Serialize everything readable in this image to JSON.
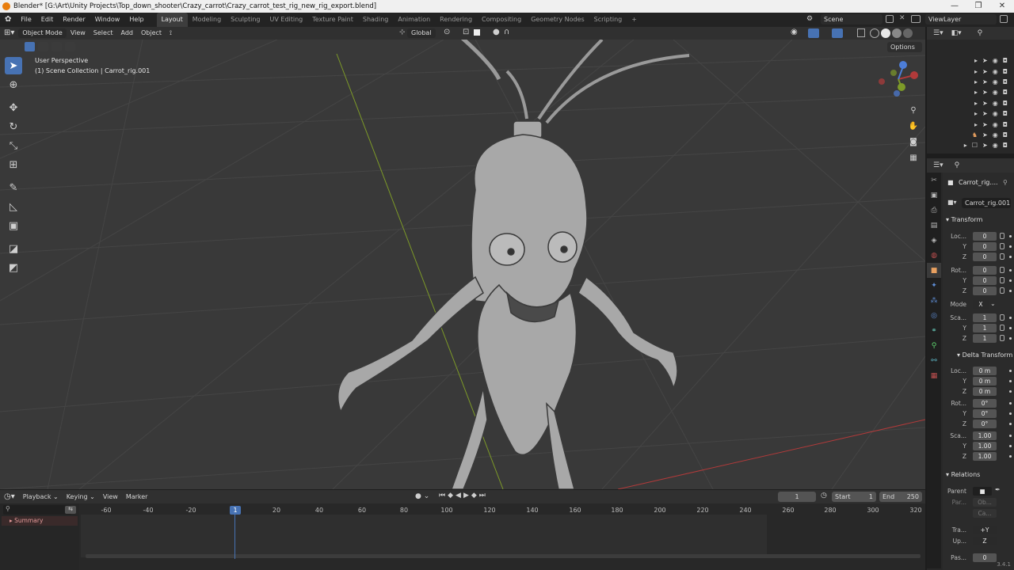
{
  "window": {
    "title": "Blender* [G:\\Art\\Unity Projects\\Top_down_shooter\\Crazy_carrot\\Crazy_carrot_test_rig_new_rig_export.blend]",
    "controls": [
      "—",
      "❐",
      "✕"
    ]
  },
  "menubar": {
    "items": [
      "File",
      "Edit",
      "Render",
      "Window",
      "Help"
    ],
    "workspaces": [
      "Layout",
      "Modeling",
      "Sculpting",
      "UV Editing",
      "Texture Paint",
      "Shading",
      "Animation",
      "Rendering",
      "Compositing",
      "Geometry Nodes",
      "Scripting"
    ],
    "active_workspace": "Layout",
    "add_workspace": "+",
    "scene_label": "Scene",
    "viewlayer_label": "ViewLayer"
  },
  "viewport_header": {
    "mode": "Object Mode",
    "menus": [
      "View",
      "Select",
      "Add",
      "Object"
    ],
    "orientation": "Global",
    "options_label": "Options"
  },
  "viewport": {
    "perspective": "User Perspective",
    "collection": "(1) Scene Collection | Carrot_rig.001",
    "gizmo_axes": [
      "X",
      "Y",
      "Z"
    ],
    "grid_color": "#454545",
    "background_color": "#393939",
    "x_axis_color": "#b13a3a",
    "y_axis_color": "#7d9a28"
  },
  "toolbar": {
    "tools": [
      "select-box",
      "cursor",
      "move",
      "rotate",
      "scale",
      "transform",
      "annotate",
      "measure",
      "add-cube",
      "shear",
      "extrude"
    ]
  },
  "outliner": {
    "rows": 9
  },
  "properties": {
    "object_name": "Carrot_rig....",
    "data_name": "Carrot_rig.001",
    "transform_title": "Transform",
    "location": {
      "label": "Loc...",
      "x": "0",
      "y": "0",
      "z": "0"
    },
    "rotation": {
      "label": "Rot...",
      "x": "0",
      "y": "0",
      "z": "0"
    },
    "mode_label": "Mode",
    "mode_value": "X",
    "scale": {
      "label": "Sca...",
      "x": "1",
      "y": "1",
      "z": "1"
    },
    "delta_title": "Delta Transform",
    "delta_location": {
      "label": "Loc...",
      "x": "0 m",
      "y": "0 m",
      "z": "0 m"
    },
    "delta_rotation": {
      "label": "Rot...",
      "x": "0°",
      "y": "0°",
      "z": "0°"
    },
    "delta_scale": {
      "label": "Sca...",
      "x": "1.00",
      "y": "1.00",
      "z": "1.00"
    },
    "relations_title": "Relations",
    "parent_label": "Parent",
    "par_label": "Par...",
    "par_value": "Ob...",
    "ca_value": "Ca...",
    "tra_label": "Tra...",
    "tra_value": "+Y",
    "up_label": "Up...",
    "up_value": "Z",
    "pas_label": "Pas...",
    "pas_value": "0",
    "axis_y": "Y",
    "axis_z": "Z"
  },
  "timeline": {
    "menus": [
      "Playback",
      "Keying",
      "View",
      "Marker"
    ],
    "current_frame": "1",
    "start_label": "Start",
    "start_value": "1",
    "end_label": "End",
    "end_value": "250",
    "summary_label": "Summary",
    "ticks": [
      "-60",
      "-40",
      "-20",
      "20",
      "40",
      "60",
      "80",
      "100",
      "120",
      "140",
      "160",
      "180",
      "200",
      "220",
      "240",
      "260",
      "280",
      "300",
      "320"
    ],
    "cursor_frame": "1"
  },
  "status": {
    "version": "3.4.1"
  }
}
